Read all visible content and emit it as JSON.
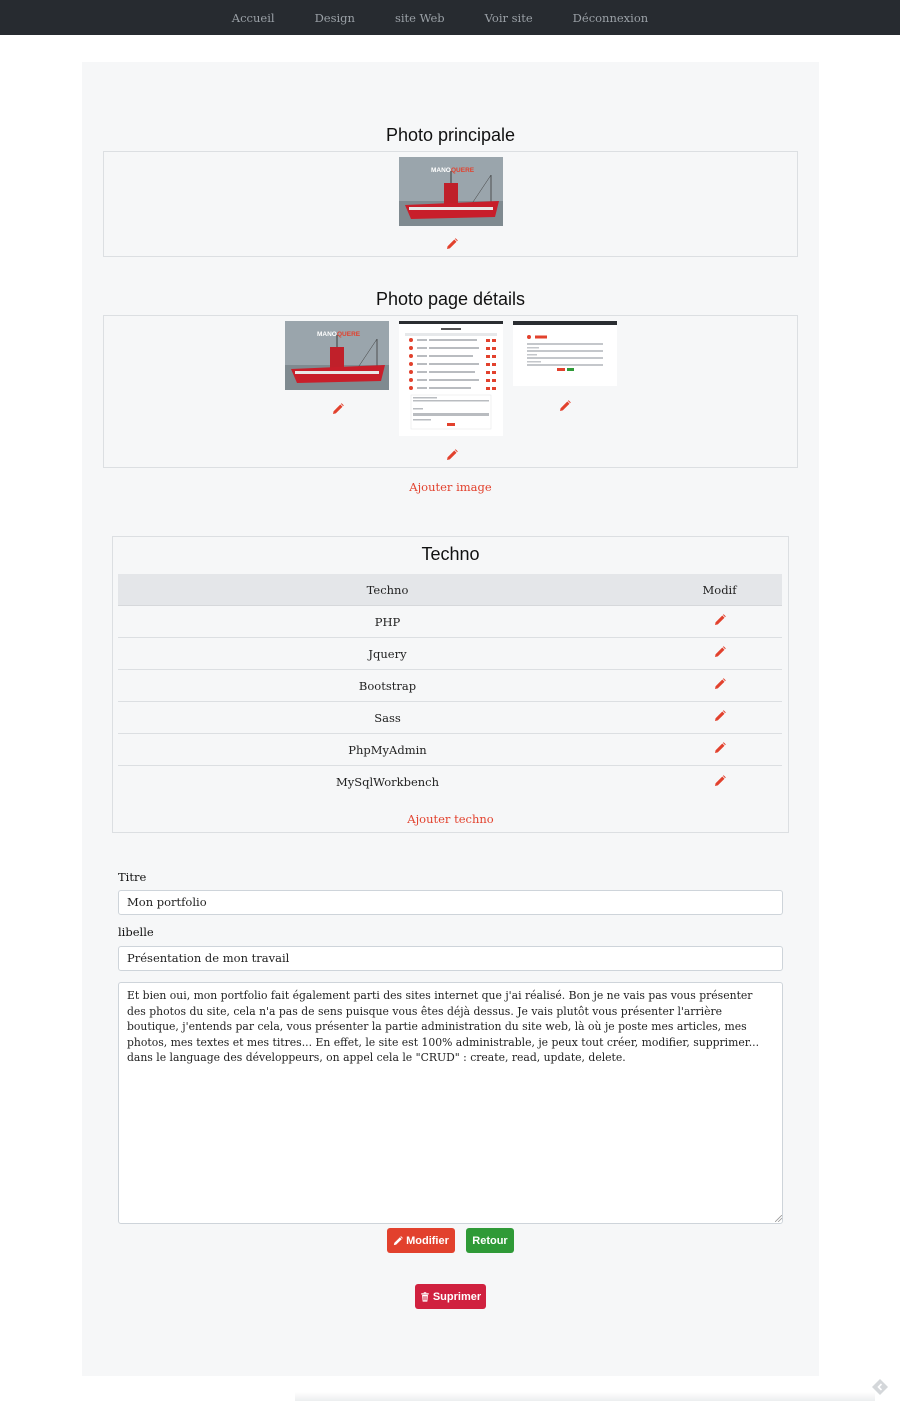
{
  "nav": {
    "items": [
      "Accueil",
      "Design",
      "site Web",
      "Voir site",
      "Déconnexion"
    ]
  },
  "main_photo": {
    "title": "Photo principale",
    "image_brand": "MANŌ QUERE",
    "image_brand_left": "MANO",
    "image_brand_right": "QUERE"
  },
  "detail_photos": {
    "title": "Photo page détails",
    "add_image_label": "Ajouter image"
  },
  "techno": {
    "title": "Techno",
    "headers": [
      "Techno",
      "Modif"
    ],
    "rows": [
      "PHP",
      "Jquery",
      "Bootstrap",
      "Sass",
      "PhpMyAdmin",
      "MySqlWorkbench"
    ],
    "add_label": "Ajouter techno"
  },
  "form": {
    "titre_label": "Titre",
    "titre_value": "Mon portfolio",
    "libelle_label": "libelle",
    "libelle_value": "Présentation de mon travail",
    "description": "Et bien oui, mon portfolio fait également parti des sites internet que j'ai réalisé. Bon je ne vais pas vous présenter des photos du site, cela n'a pas de sens puisque vous êtes déjà dessus. Je vais plutôt vous présenter l'arrière boutique, j'entends par cela, vous présenter la partie administration du site web, là où je poste mes articles, mes photos, mes textes et mes titres... En effet, le site est 100% administrable, je peux tout créer, modifier, supprimer... dans le language des développeurs, on appel cela le \"CRUD\" : create, read, update, delete."
  },
  "buttons": {
    "modifier": "Modifier",
    "retour": "Retour",
    "supprimer": "Suprimer"
  },
  "colors": {
    "nav_bg": "#272b30",
    "accent_red": "#e2412d",
    "danger": "#d0213f",
    "success": "#2f9a37",
    "panel_bg": "#f6f7f8"
  },
  "icons": {
    "edit": "pencil-icon",
    "delete": "trash-icon"
  }
}
